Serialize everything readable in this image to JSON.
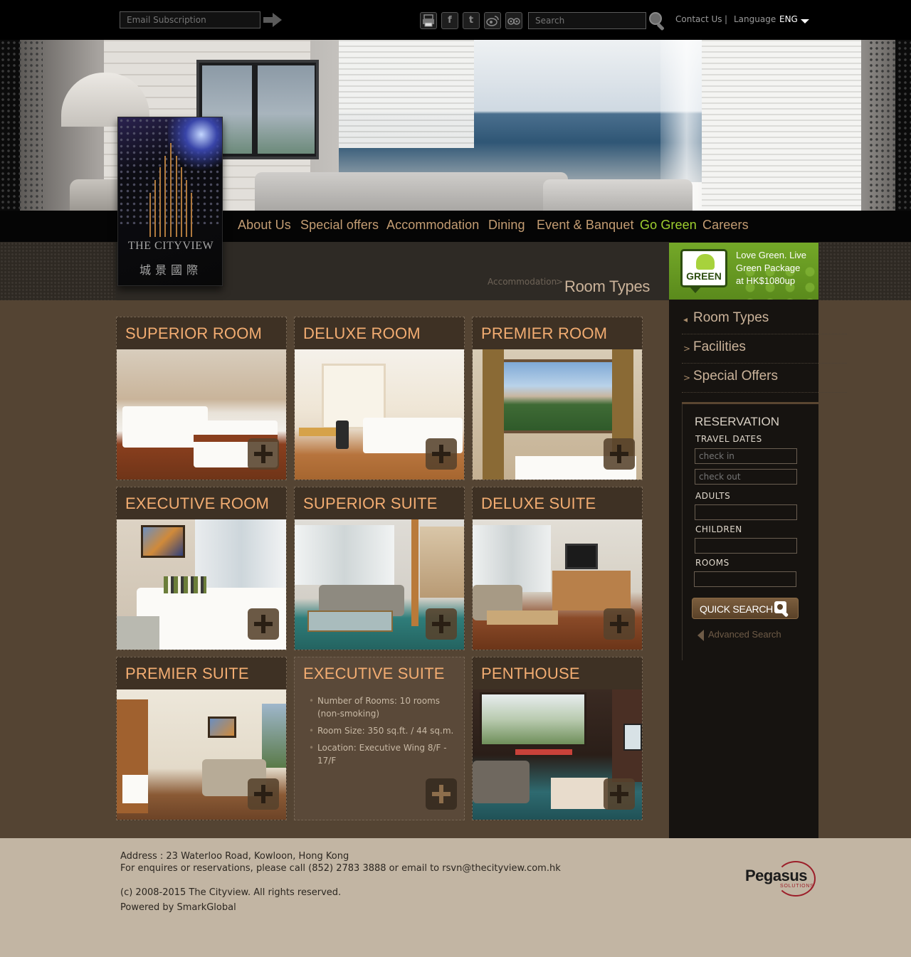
{
  "topbar": {
    "email_placeholder": "Email Subscription",
    "search_placeholder": "Search",
    "contact_label": "Contact Us",
    "separator": "|",
    "language_label": "Language",
    "language_value": "ENG",
    "social_icons": [
      "print-icon",
      "facebook-icon",
      "twitter-icon",
      "weibo-icon",
      "tripadvisor-icon"
    ]
  },
  "logo": {
    "text": "THE CITYVIEW",
    "chinese": "城景國際"
  },
  "nav": {
    "items": [
      "About Us",
      "Special offers",
      "Accommodation",
      "Dining",
      "Event & Banquet",
      "Go Green",
      "Careers"
    ],
    "highlight_color": "#9fcf2f",
    "link_color": "#c49d73"
  },
  "breadcrumb": {
    "parent": "Accommodation",
    "separator": ">",
    "current": "Room Types"
  },
  "green_promo": {
    "badge": "GREEN",
    "line1": "Love Green. Live",
    "line2": "Green Package",
    "line3": "at HK$1080up"
  },
  "sidebar": {
    "items": [
      {
        "arrow": "◂",
        "label": "Room Types"
      },
      {
        "arrow": ">",
        "label": "Facilities"
      },
      {
        "arrow": ">",
        "label": "Special Offers"
      }
    ]
  },
  "reservation": {
    "title": "RESERVATION",
    "travel_dates": "TRAVEL DATES",
    "check_in_placeholder": "check in",
    "check_out_placeholder": "check out",
    "adults_label": "ADULTS",
    "children_label": "CHILDREN",
    "rooms_label": "ROOMS",
    "quick_search": "QUICK SEARCH",
    "advanced_search": "Advanced Search"
  },
  "rooms": [
    {
      "title": "SUPERIOR ROOM"
    },
    {
      "title": "DELUXE ROOM"
    },
    {
      "title": "PREMIER ROOM"
    },
    {
      "title": "EXECUTIVE ROOM"
    },
    {
      "title": "SUPERIOR SUITE"
    },
    {
      "title": "DELUXE SUITE"
    },
    {
      "title": "PREMIER SUITE"
    },
    {
      "title": "EXECUTIVE SUITE",
      "details": [
        "Number of Rooms: 10 rooms (non-smoking)",
        "Room Size: 350 sq.ft. / 44 sq.m.",
        "Location: Executive Wing 8/F - 17/F"
      ]
    },
    {
      "title": "PENTHOUSE"
    }
  ],
  "footer": {
    "address": "Address : 23 Waterloo Road, Kowloon, Hong Kong",
    "contact": "For enquires or reservations, please call (852) 2783 3888 or email to rsvn@thecityview.com.hk",
    "copyright": "(c) 2008-2015 The Cityview. All rights reserved.",
    "powered": "Powered by SmarkGlobal",
    "partner_logo": "Pegasus",
    "partner_sub": "SOLUTIONS"
  }
}
